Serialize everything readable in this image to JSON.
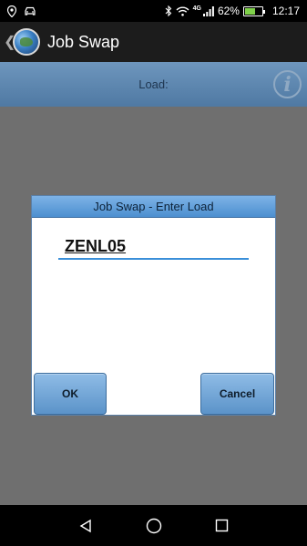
{
  "status_bar": {
    "network_type": "4G",
    "battery_percent_text": "62%",
    "battery_level": 0.62,
    "time": "12:17",
    "left_icons": [
      "location-icon",
      "car-icon"
    ],
    "right_icons": [
      "bluetooth-icon",
      "wifi-icon",
      "signal-icon",
      "battery-icon"
    ]
  },
  "app_bar": {
    "back_glyph": "❮",
    "title": "Job Swap"
  },
  "sub_header": {
    "label": "Load:",
    "info_glyph": "i"
  },
  "dialog": {
    "title": "Job Swap - Enter Load",
    "input_value": "ZENL05",
    "ok_label": "OK",
    "cancel_label": "Cancel"
  },
  "nav_bar": {
    "icons": [
      "back-triangle-icon",
      "home-circle-icon",
      "recents-square-icon"
    ]
  },
  "colors": {
    "header_blue": "#5f88b1",
    "dialog_title_blue": "#6aa3dc",
    "input_underline": "#3a8fd9",
    "battery_green": "#7fd14a"
  }
}
